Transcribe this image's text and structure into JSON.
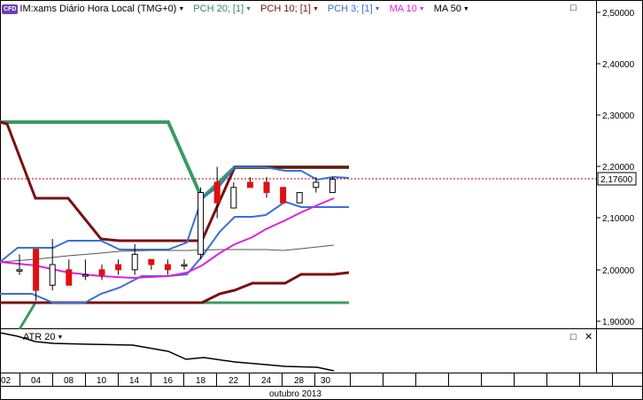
{
  "header": {
    "badge": "CFD",
    "symbol": "IM:xams Diário Hora Local (TMG+0)",
    "indicators": [
      {
        "label": "PCH 20; [1]",
        "color": "#2e8b57"
      },
      {
        "label": "PCH 10; [1]",
        "color": "#7a0f0f"
      },
      {
        "label": "PCH 3; [1]",
        "color": "#3a6fd8"
      },
      {
        "label": "MA 10",
        "color": "#e020e0"
      },
      {
        "label": "MA 50",
        "color": "#000000"
      }
    ]
  },
  "controls": {
    "main_maximize": "□",
    "sub_maximize": "□",
    "sub_close": "✕"
  },
  "price_axis": {
    "ticks": [
      "2,50000",
      "2,40000",
      "2,30000",
      "2,20000",
      "2,10000",
      "2,00000",
      "1,90000"
    ],
    "current_price": "2,17600"
  },
  "sub_panel": {
    "label": "ATR 20"
  },
  "time_axis": {
    "day_labels": [
      "02",
      "04",
      "08",
      "10",
      "14",
      "16",
      "18",
      "22",
      "24",
      "28",
      "30"
    ],
    "month_label": "outubro 2013"
  },
  "chart_data": {
    "type": "candlestick",
    "ylim": [
      1.88,
      2.52
    ],
    "current_price": 2.176,
    "candles": [
      {
        "o": 2.0,
        "h": 2.03,
        "l": 1.99,
        "c": 2.0
      },
      {
        "o": 2.04,
        "h": 2.04,
        "l": 1.94,
        "c": 1.96
      },
      {
        "o": 1.97,
        "h": 2.06,
        "l": 1.96,
        "c": 2.01
      },
      {
        "o": 2.0,
        "h": 2.02,
        "l": 1.97,
        "c": 1.97
      },
      {
        "o": 1.99,
        "h": 2.02,
        "l": 1.98,
        "c": 1.99
      },
      {
        "o": 2.0,
        "h": 2.01,
        "l": 1.98,
        "c": 1.99
      },
      {
        "o": 2.01,
        "h": 2.02,
        "l": 1.99,
        "c": 2.0
      },
      {
        "o": 2.0,
        "h": 2.05,
        "l": 1.99,
        "c": 2.03
      },
      {
        "o": 2.02,
        "h": 2.02,
        "l": 2.0,
        "c": 2.01
      },
      {
        "o": 2.01,
        "h": 2.02,
        "l": 1.99,
        "c": 2.0
      },
      {
        "o": 2.01,
        "h": 2.02,
        "l": 2.0,
        "c": 2.01
      },
      {
        "o": 2.03,
        "h": 2.16,
        "l": 2.02,
        "c": 2.15
      },
      {
        "o": 2.17,
        "h": 2.2,
        "l": 2.1,
        "c": 2.13
      },
      {
        "o": 2.12,
        "h": 2.17,
        "l": 2.12,
        "c": 2.16
      },
      {
        "o": 2.17,
        "h": 2.18,
        "l": 2.16,
        "c": 2.16
      },
      {
        "o": 2.17,
        "h": 2.18,
        "l": 2.14,
        "c": 2.15
      },
      {
        "o": 2.16,
        "h": 2.16,
        "l": 2.13,
        "c": 2.13
      },
      {
        "o": 2.13,
        "h": 2.15,
        "l": 2.13,
        "c": 2.15
      },
      {
        "o": 2.16,
        "h": 2.18,
        "l": 2.15,
        "c": 2.17
      },
      {
        "o": 2.15,
        "h": 2.18,
        "l": 2.15,
        "c": 2.176
      }
    ]
  }
}
